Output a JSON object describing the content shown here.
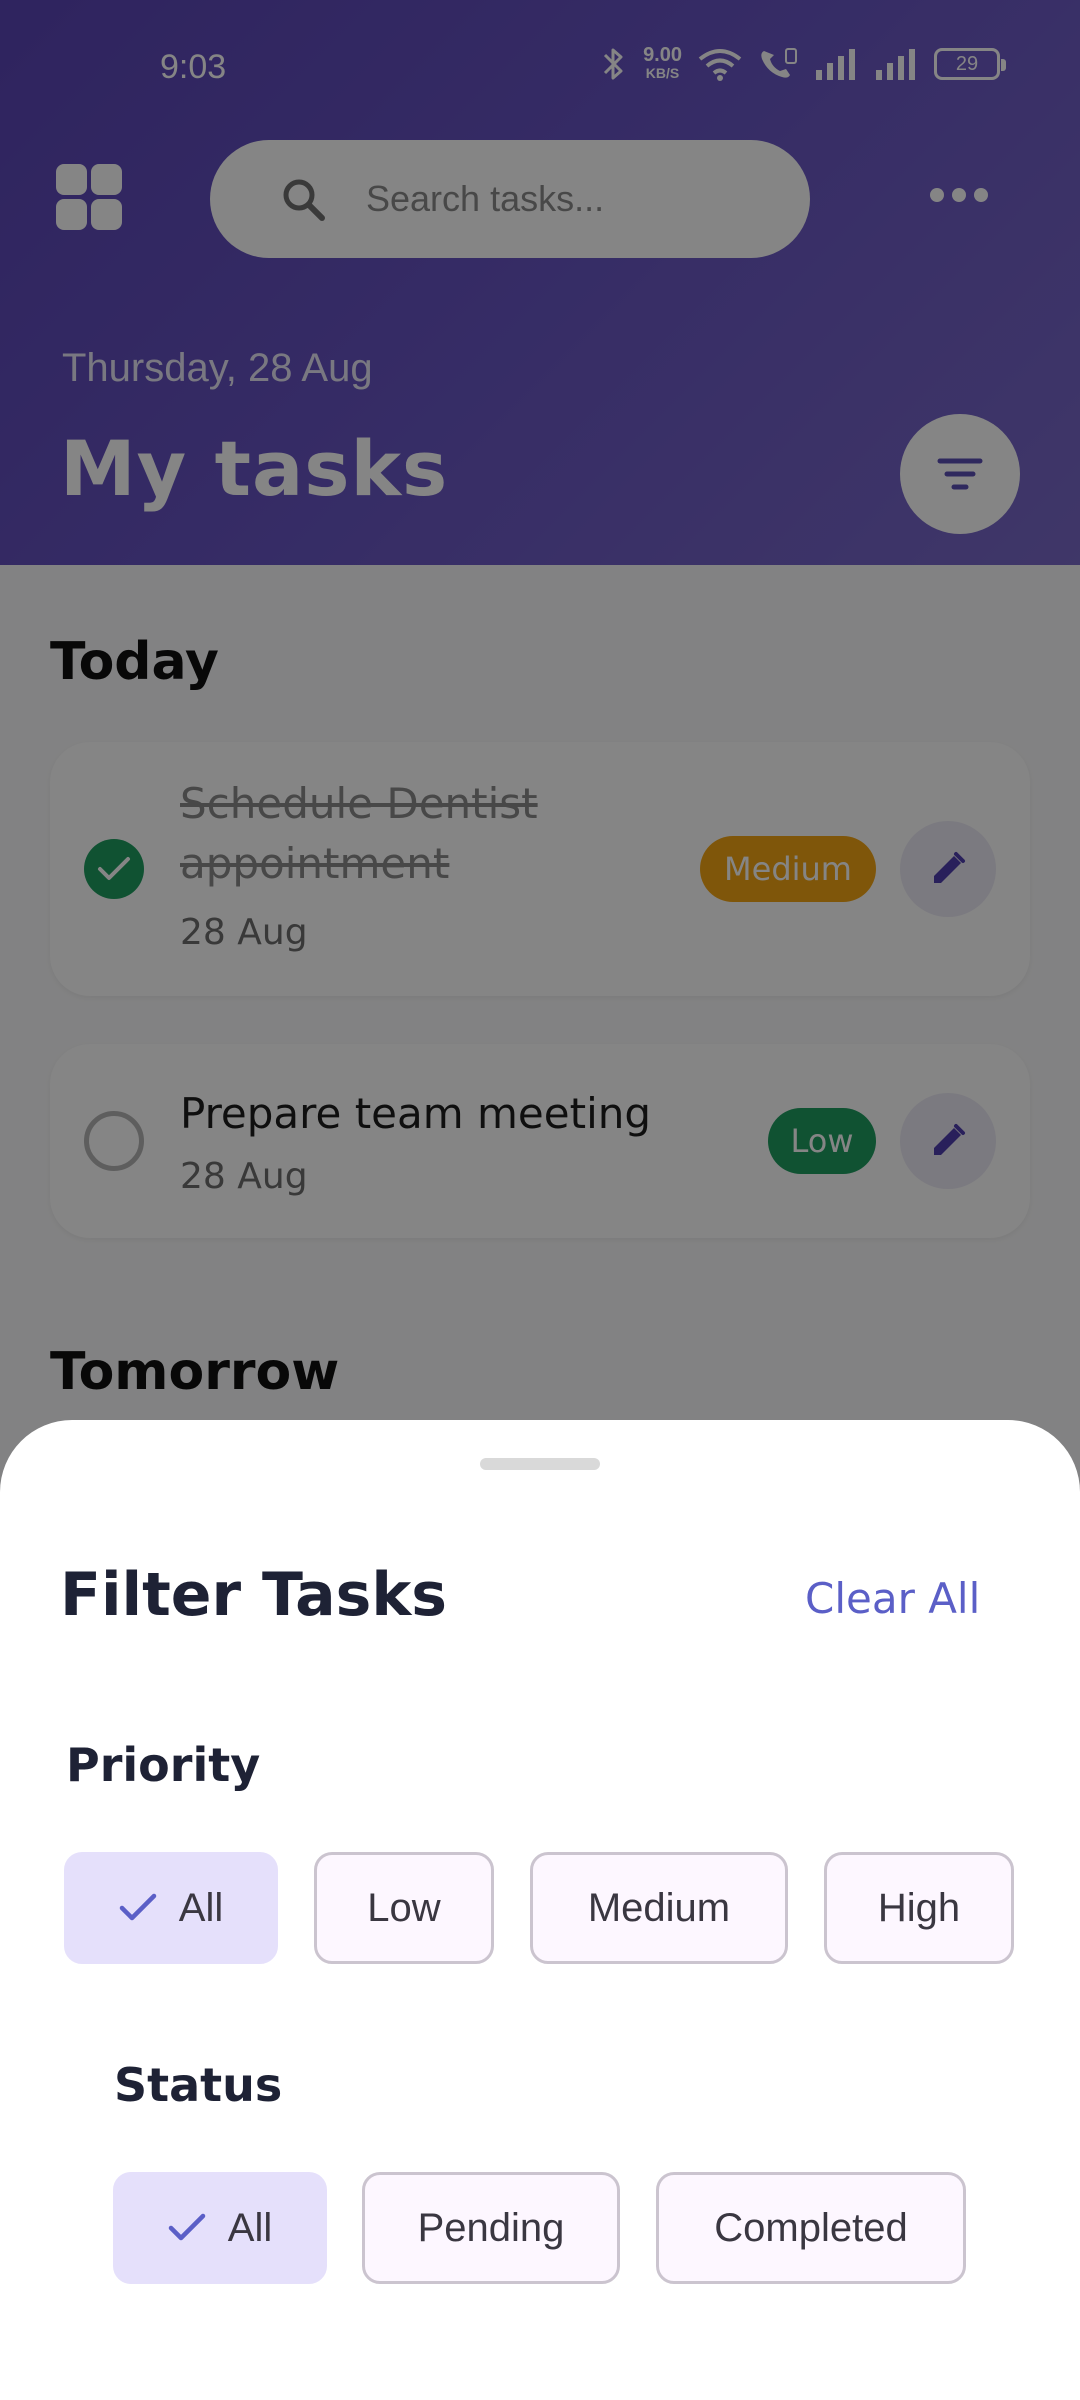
{
  "status_bar": {
    "time": "9:03",
    "net_speed_value": "9.00",
    "net_speed_unit": "KB/S",
    "battery_level": "29",
    "icons": [
      "bluetooth-icon",
      "wifi-icon",
      "call-icon",
      "signal-icon",
      "signal-icon",
      "battery-icon"
    ]
  },
  "header": {
    "search_placeholder": "Search tasks...",
    "date": "Thursday, 28 Aug",
    "title": "My tasks",
    "background_color": "#5a45b6"
  },
  "sections": [
    {
      "title": "Today",
      "tasks": [
        {
          "title": "Schedule Dentist appointment",
          "date": "28 Aug",
          "priority": "Medium",
          "completed": true
        },
        {
          "title": "Prepare team meeting",
          "date": "28 Aug",
          "priority": "Low",
          "completed": false
        }
      ]
    },
    {
      "title": "Tomorrow",
      "tasks": []
    }
  ],
  "filter_sheet": {
    "title": "Filter Tasks",
    "clear_label": "Clear All",
    "priority": {
      "label": "Priority",
      "options": [
        "All",
        "Low",
        "Medium",
        "High"
      ],
      "selected": "All"
    },
    "status": {
      "label": "Status",
      "options": [
        "All",
        "Pending",
        "Completed"
      ],
      "selected": "All"
    }
  },
  "colors": {
    "accent": "#5b5fc7",
    "priority_medium": "#f3a614",
    "priority_low": "#1f9d61",
    "chip_selected": "#e5e0fb"
  }
}
